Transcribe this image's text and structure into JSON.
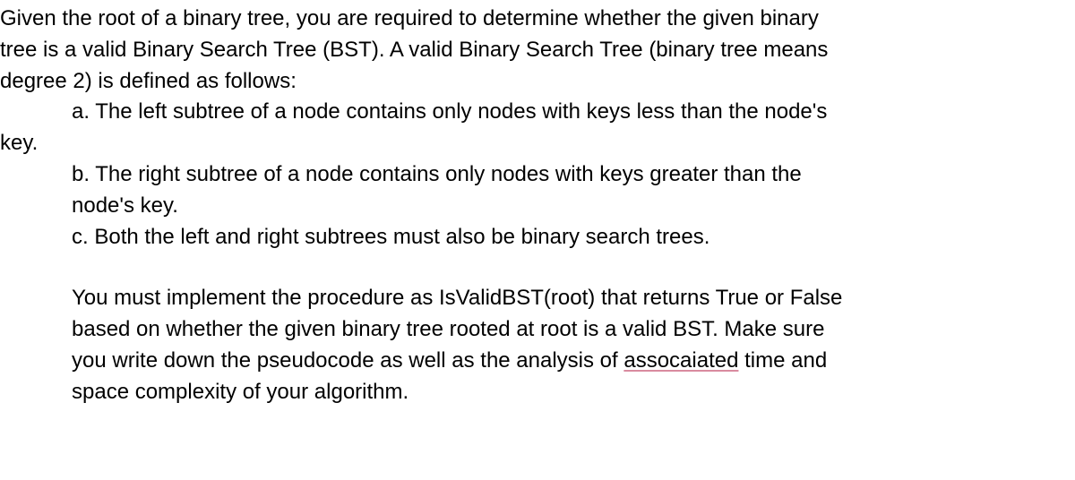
{
  "intro": {
    "line1": "Given the root of a binary tree, you are required to determine whether the given binary",
    "line2": "tree is a valid Binary Search Tree (BST). A valid Binary Search Tree (binary tree means",
    "line3": "degree 2) is defined as follows:"
  },
  "item_a": "a. The left subtree of a node contains only nodes with keys less than the node's",
  "key_line": "key.",
  "item_b_line1": "b. The right subtree of a node contains only nodes with keys greater than the",
  "item_b_line2": "node's key.",
  "item_c": "c. Both the left and right subtrees must also be binary search trees.",
  "task": {
    "line1": "You must implement the procedure as IsValidBST(root) that returns True or False",
    "line2": "based on whether the given binary tree rooted at root is a valid BST. Make sure",
    "line3_a": "you write down the pseudocode as well as the analysis of ",
    "line3_misspell": "assocaiated",
    "line3_b": " time and",
    "line4": "space complexity of your algorithm."
  }
}
